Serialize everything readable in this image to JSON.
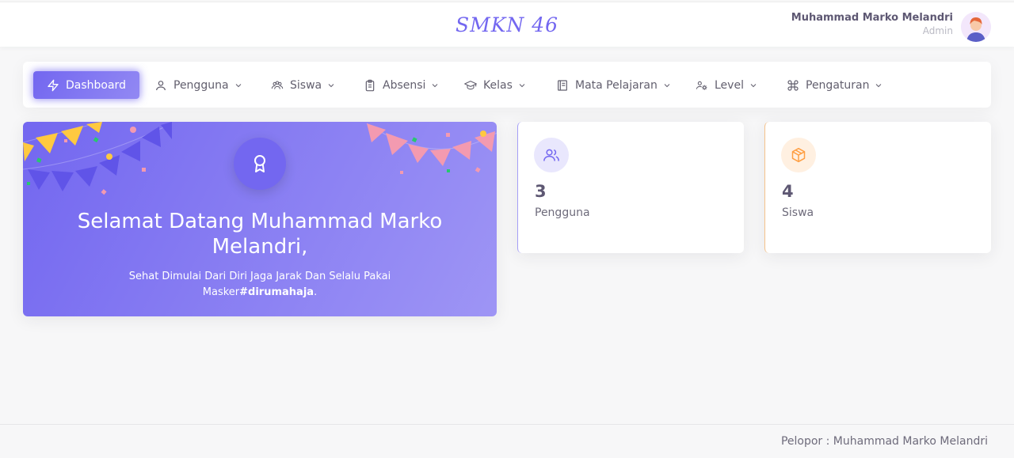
{
  "header": {
    "brand": "SMKN 46",
    "user_name": "Muhammad Marko Melandri",
    "user_role": "Admin"
  },
  "menu": {
    "dashboard": "Dashboard",
    "pengguna": "Pengguna",
    "siswa": "Siswa",
    "absensi": "Absensi",
    "kelas": "Kelas",
    "mata_pelajaran": "Mata Pelajaran",
    "level": "Level",
    "pengaturan": "Pengaturan"
  },
  "welcome": {
    "title": "Selamat Datang Muhammad Marko Melandri,",
    "subtitle": "Sehat Dimulai Dari Diri Jaga Jarak Dan Selalu Pakai Masker",
    "hashtag": "#dirumahaja",
    "suffix": "."
  },
  "stats": [
    {
      "value": "3",
      "label": "Pengguna",
      "icon": "users-icon",
      "color": "#7367f0"
    },
    {
      "value": "4",
      "label": "Siswa",
      "icon": "box-icon",
      "color": "#ff9f43"
    }
  ],
  "footer": {
    "text": "Pelopor : Muhammad Marko Melandri"
  },
  "colors": {
    "primary": "#7367f0",
    "warning": "#ff9f43",
    "background": "#f7f7f8"
  }
}
